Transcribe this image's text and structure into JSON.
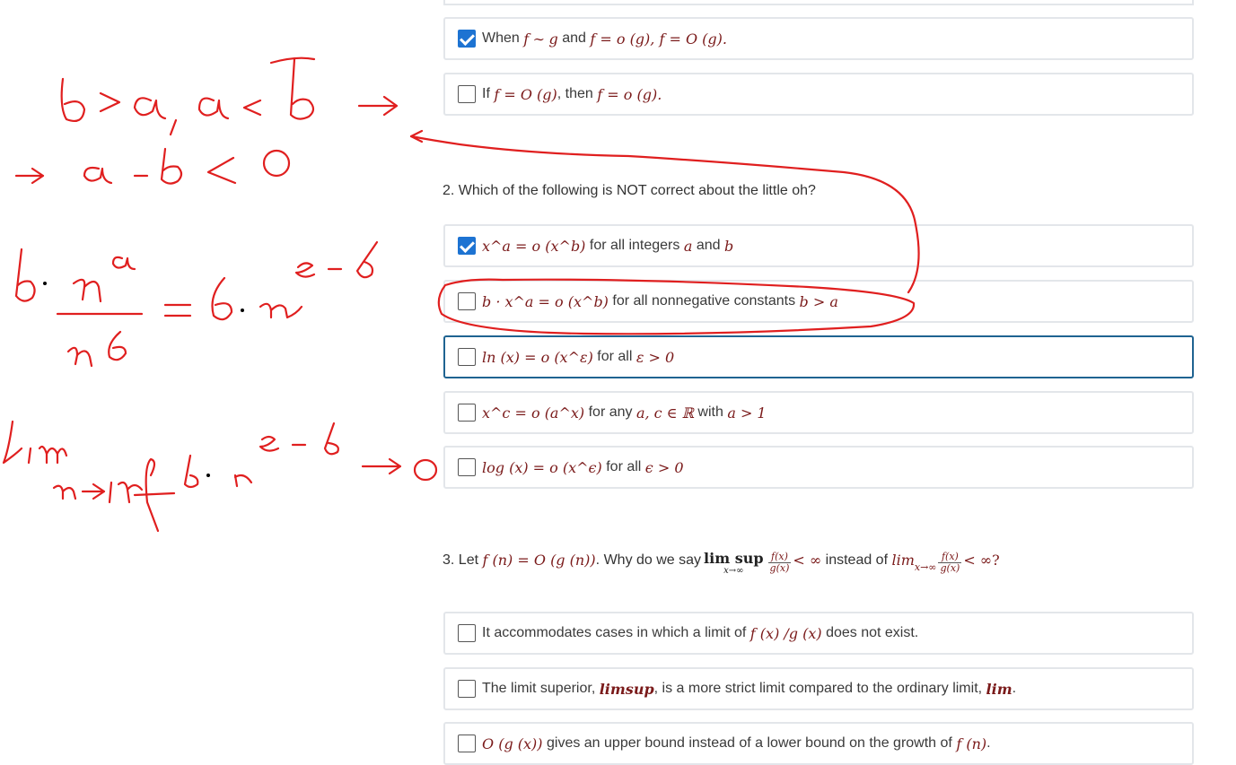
{
  "q1": {
    "options": [
      {
        "pre": "When",
        "a": "f",
        "b": "∼",
        "c": "g",
        "d": "and",
        "e": "f = o (g), f = O (g).",
        "checked": true
      },
      {
        "pre": "If",
        "a": "f = O (g)",
        "d": ", then",
        "e": "f = o (g).",
        "checked": false
      }
    ]
  },
  "q2": {
    "prompt": "2. Which of the following is NOT correct about the little oh?",
    "options": [
      {
        "math": "x^a = o (x^b)",
        "text": "for all integers",
        "m1": "a",
        "and": "and",
        "m2": "b",
        "checked": true
      },
      {
        "math": "b · x^a = o (x^b)",
        "text": "for all nonnegative constants",
        "m1": "b > a",
        "checked": false
      },
      {
        "math": "ln (x) = o (x^ε)",
        "text": "for all",
        "m1": "ε > 0",
        "checked": false,
        "focused": true
      },
      {
        "math": "x^c = o (a^x)",
        "text": "for any",
        "m1": "a, c ∈ ℝ",
        "with": "with",
        "m2": "a > 1",
        "checked": false
      },
      {
        "math": "log (x) = o (x^ϵ)",
        "text": "for all",
        "m1": "ϵ > 0",
        "checked": false
      }
    ]
  },
  "q3": {
    "prompt_pre": "3. Let",
    "prompt_math": "f (n) = O (g (n))",
    "prompt_mid": ". Why do we say",
    "limsup": "lim sup",
    "limsub": "x→∞",
    "frac_num": "f(x)",
    "frac_den": "g(x)",
    "lt_inf": "< ∞",
    "instead": "instead of",
    "lim2": "lim",
    "lim2sub": "x→∞",
    "lt_inf2": "< ∞?",
    "options": [
      {
        "pre": "It accommodates cases in which a limit of",
        "math": "f (x) /g (x)",
        "post": "does not exist.",
        "checked": false
      },
      {
        "pre": "The limit superior,",
        "math": "limsup",
        "post": ", is a more strict limit compared to the ordinary limit,",
        "math2": "lim",
        "post2": ".",
        "checked": false
      },
      {
        "math": "O (g (x))",
        "pre": "gives an upper bound instead of a lower bound on the growth of",
        "math2": "f (n)",
        "post2": ".",
        "checked": false
      }
    ]
  }
}
